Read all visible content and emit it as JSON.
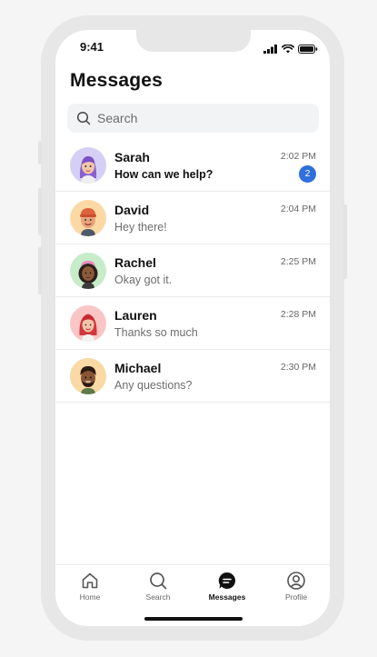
{
  "status_bar": {
    "time": "9:41"
  },
  "header": {
    "title": "Messages"
  },
  "search": {
    "placeholder": "Search"
  },
  "conversations": [
    {
      "name": "Sarah",
      "preview": "How can we help?",
      "time": "2:02 PM",
      "unread_count": "2",
      "avatar_color": "#d6cff5"
    },
    {
      "name": "David",
      "preview": "Hey there!",
      "time": "2:04 PM",
      "avatar_color": "#fbd9a4"
    },
    {
      "name": "Rachel",
      "preview": "Okay got it.",
      "time": "2:25 PM",
      "avatar_color": "#c6ecc9"
    },
    {
      "name": "Lauren",
      "preview": "Thanks so much",
      "time": "2:28 PM",
      "avatar_color": "#f9c5c5"
    },
    {
      "name": "Michael",
      "preview": "Any questions?",
      "time": "2:30 PM",
      "avatar_color": "#fbd9a4"
    }
  ],
  "tabbar": {
    "tabs": [
      {
        "label": "Home",
        "icon": "home-icon"
      },
      {
        "label": "Search",
        "icon": "search-icon"
      },
      {
        "label": "Messages",
        "icon": "chat-bubble-icon",
        "active": true
      },
      {
        "label": "Profile",
        "icon": "profile-icon"
      }
    ]
  },
  "colors": {
    "accent": "#2f6fdc",
    "frame": "#e7e7e8",
    "background": "#f5f5f5"
  }
}
